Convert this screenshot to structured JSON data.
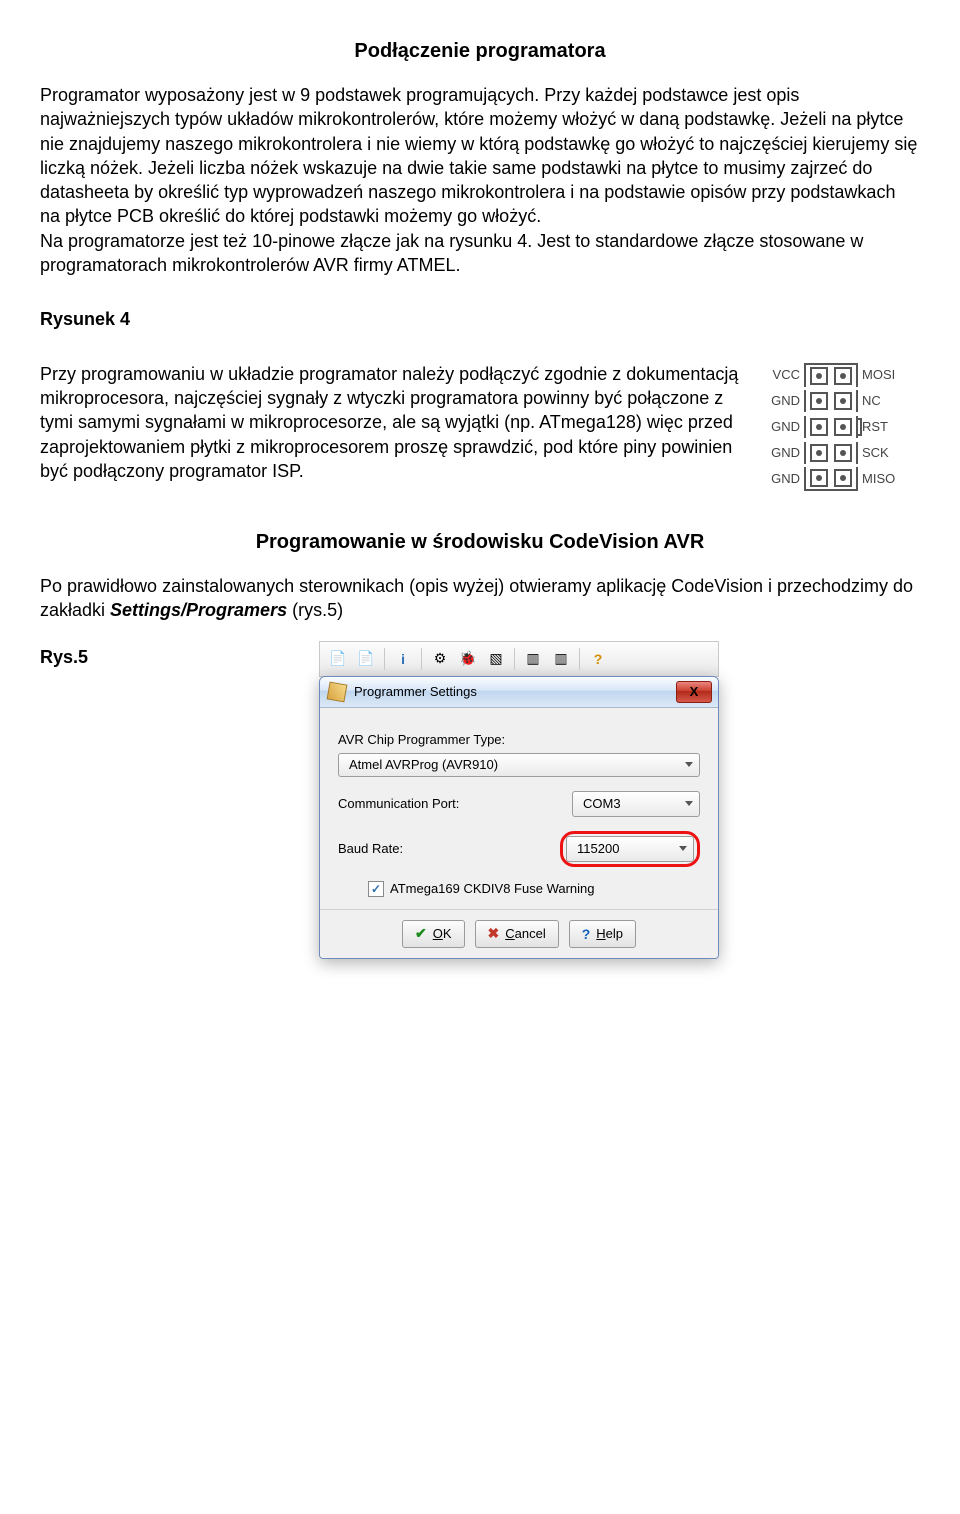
{
  "title": "Podłączenie programatora",
  "paragraph1": "Programator wyposażony jest w 9 podstawek programujących. Przy każdej podstawce jest opis najważniejszych typów układów mikrokontrolerów, które możemy włożyć w daną podstawkę. Jeżeli na płytce nie znajdujemy naszego mikrokontrolera i nie wiemy w którą podstawkę go włożyć to najczęściej kierujemy się liczką nóżek. Jeżeli liczba nóżek wskazuje na dwie takie same podstawki na płytce to musimy zajrzeć do datasheeta by określić typ wyprowadzeń naszego mikrokontrolera i na podstawie opisów przy podstawkach na płytce PCB określić do której podstawki możemy go włożyć.\nNa programatorze jest też 10-pinowe złącze jak na rysunku 4. Jest to standardowe złącze stosowane w programatorach mikrokontrolerów AVR firmy ATMEL.",
  "fig4_label": "Rysunek 4",
  "paragraph2": "Przy programowaniu w układzie programator należy podłączyć zgodnie z dokumentacją mikroprocesora, najczęściej sygnały z wtyczki programatora powinny być połączone z tymi samymi sygnałami w mikroprocesorze, ale są wyjątki (np. ATmega128) więc przed zaprojektowaniem płytki z mikroprocesorem proszę sprawdzić, pod które piny powinien być podłączony programator ISP.",
  "connector": {
    "rows": [
      {
        "l": "VCC",
        "r": "MOSI"
      },
      {
        "l": "GND",
        "r": "NC"
      },
      {
        "l": "GND",
        "r": "RST"
      },
      {
        "l": "GND",
        "r": "SCK"
      },
      {
        "l": "GND",
        "r": "MISO"
      }
    ]
  },
  "heading2": "Programowanie w środowisku CodeVision AVR",
  "paragraph3_pre": "Po prawidłowo zainstalowanych sterownikach (opis wyżej) otwieramy aplikację CodeVision i przechodzimy do zakładki ",
  "paragraph3_italic": "Settings/Programers",
  "paragraph3_post": " (rys.5)",
  "fig5_label": "Rys.5",
  "dialog": {
    "title": "Programmer Settings",
    "type_label": "AVR Chip Programmer Type:",
    "type_value": "Atmel AVRProg (AVR910)",
    "port_label": "Communication Port:",
    "port_value": "COM3",
    "baud_label": "Baud Rate:",
    "baud_value": "115200",
    "warning_label": "ATmega169 CKDIV8 Fuse Warning",
    "ok": "OK",
    "cancel": "Cancel",
    "help": "Help",
    "close_x": "X"
  },
  "helpmark": "?"
}
